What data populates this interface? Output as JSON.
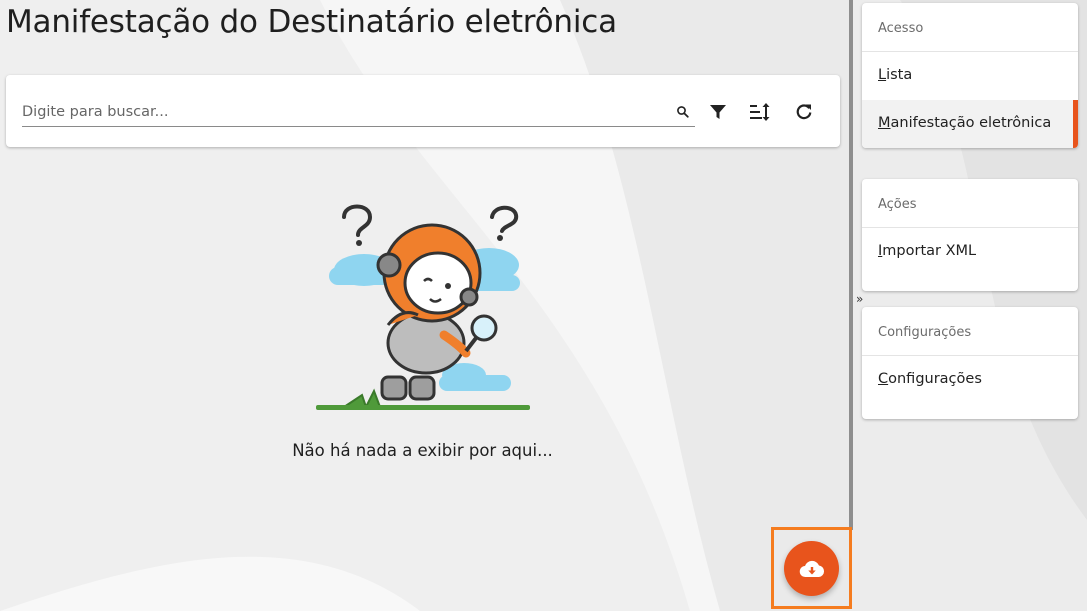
{
  "header": {
    "title": "Manifestação do Destinatário eletrônica"
  },
  "search": {
    "placeholder": "Digite para buscar...",
    "value": ""
  },
  "toolbar": {
    "icons": [
      "search-icon",
      "filter-icon",
      "sort-icon",
      "refresh-icon"
    ]
  },
  "empty_state": {
    "message": "Não há nada a exibir por aqui..."
  },
  "sidebar": {
    "collapse_glyph": "»",
    "sections": [
      {
        "heading": "Acesso",
        "items": [
          {
            "first": "L",
            "rest": "ista",
            "active": false
          },
          {
            "first": "M",
            "rest": "anifestação eletrônica",
            "active": true
          }
        ]
      },
      {
        "heading": "Ações",
        "items": [
          {
            "first": "I",
            "rest": "mportar XML",
            "active": false
          }
        ]
      },
      {
        "heading": "Configurações",
        "items": [
          {
            "first": "C",
            "rest": "onfigurações",
            "active": false
          }
        ]
      }
    ]
  },
  "fab": {
    "icon": "cloud-download-icon"
  },
  "colors": {
    "accent": "#e8541c",
    "highlight_frame": "#f57c1f",
    "mascot_orange": "#f07f2c",
    "cloud_blue": "#8fd5f0",
    "grass_green": "#4f9a3a"
  }
}
